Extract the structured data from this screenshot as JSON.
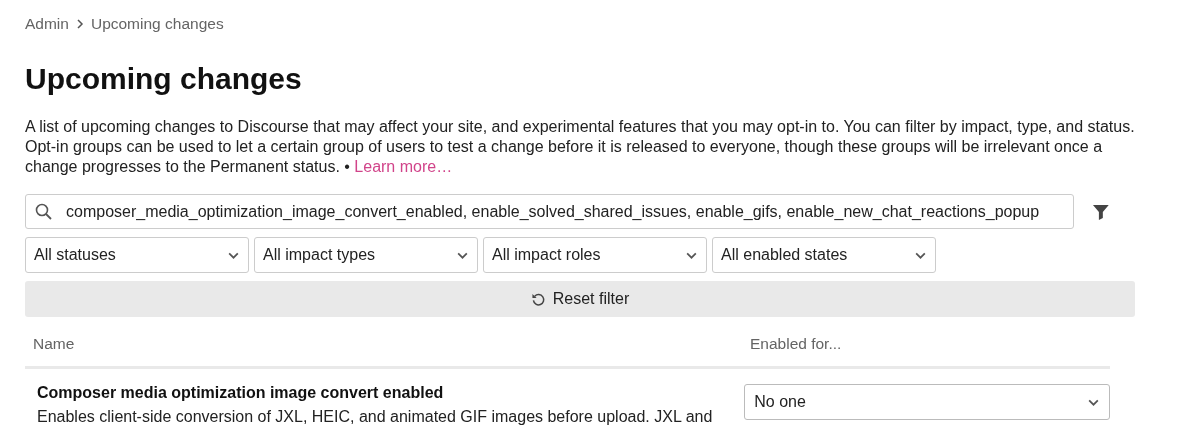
{
  "breadcrumb": [
    {
      "label": "Admin"
    },
    {
      "label": "Upcoming changes"
    }
  ],
  "title": "Upcoming changes",
  "description": {
    "text": "A list of upcoming changes to Discourse that may affect your site, and experimental features that you may opt-in to. You can filter by impact, type, and status. Opt-in groups can be used to let a certain group of users to test a change before it is released to everyone, though these groups will be irrelevant once a change progresses to the Permanent status. •",
    "link": "Learn more…"
  },
  "search": {
    "value": "composer_media_optimization_image_convert_enabled, enable_solved_shared_issues, enable_gifs, enable_new_chat_reactions_popup"
  },
  "filters": [
    {
      "value": "All statuses"
    },
    {
      "value": "All impact types"
    },
    {
      "value": "All impact roles"
    },
    {
      "value": "All enabled states"
    }
  ],
  "reset_button": "Reset filter",
  "table": {
    "columns": [
      "Name",
      "Enabled for..."
    ],
    "rows": [
      {
        "name": "Composer media optimization image convert enabled",
        "description": "Enables client-side conversion of JXL, HEIC, and animated GIF images before upload. JXL and",
        "enabled_for": "No one"
      }
    ]
  }
}
